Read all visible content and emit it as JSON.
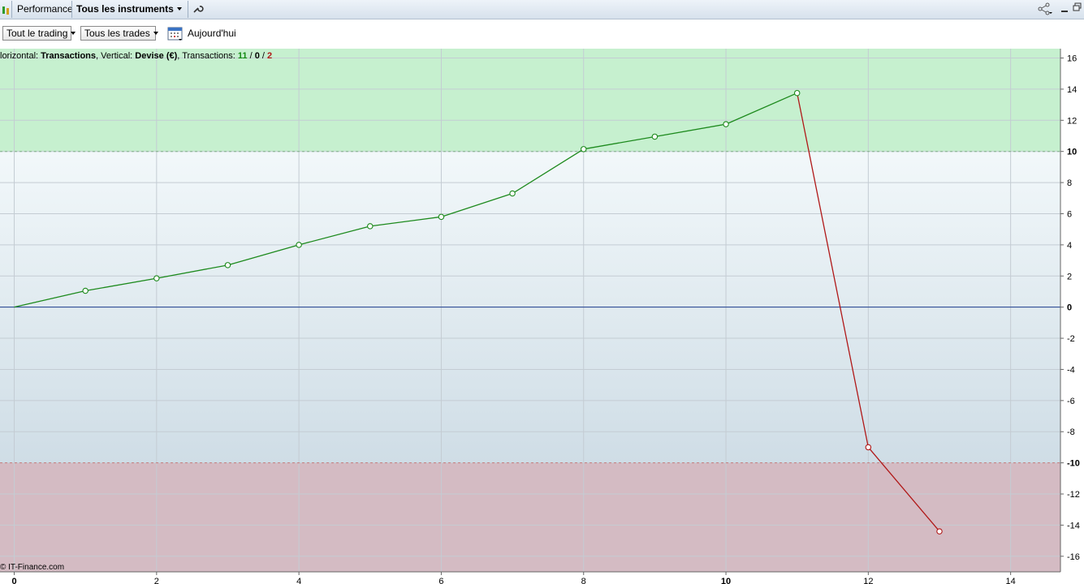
{
  "window": {
    "tab_performance": "Performance",
    "instrument_label": "Tous les instruments"
  },
  "toolbar": {
    "period_select": "Tout le trading",
    "trades_select": "Tous les trades",
    "today_label": "Aujourd'hui"
  },
  "legend": {
    "prefix": "lorizontal: ",
    "horizontal": "Transactions",
    "mid": ", Vertical: ",
    "vertical": "Devise (€)",
    "tx_label": ", Transactions: ",
    "wins": "11",
    "slash1": " / ",
    "neutral": "0",
    "slash2": " / ",
    "losses": "2"
  },
  "watermark": "© IT-Finance.com",
  "colors": {
    "up_line": "#1d8a1d",
    "down_line": "#b01818",
    "zero_line": "#1f3f8f",
    "upper_zone": "#c6f0cf",
    "lower_zone": "#d4bbc3",
    "wins_text": "#138a13",
    "losses_text": "#b01818"
  },
  "chart_data": {
    "type": "line",
    "x": [
      0,
      1,
      2,
      3,
      4,
      5,
      6,
      7,
      8,
      9,
      10,
      11,
      12,
      13
    ],
    "y": [
      0,
      1.05,
      1.85,
      2.7,
      4.0,
      5.2,
      5.8,
      7.3,
      10.15,
      10.95,
      11.75,
      13.75,
      -9.0,
      -14.4
    ],
    "xlim": [
      -0.2,
      14.7
    ],
    "ylim": [
      -17,
      16.6
    ],
    "x_ticks": [
      0,
      2,
      4,
      6,
      8,
      10,
      12,
      14
    ],
    "y_ticks": [
      16,
      14,
      12,
      10,
      8,
      6,
      4,
      2,
      0,
      -2,
      -4,
      -6,
      -8,
      -10,
      -12,
      -14,
      -16
    ],
    "bold_y_ticks": [
      10,
      0,
      -10
    ],
    "bold_x_ticks": [
      0,
      10
    ],
    "upper_threshold": 10,
    "lower_threshold": -10,
    "grid": true
  }
}
